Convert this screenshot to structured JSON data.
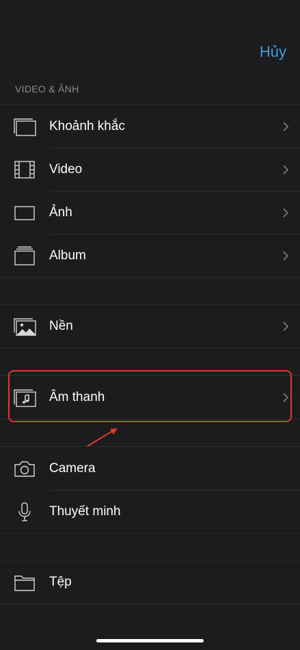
{
  "header": {
    "cancel_label": "Hủy"
  },
  "section_video_photo": {
    "title": "VIDEO & ẢNH",
    "items": [
      {
        "label": "Khoảnh khắc",
        "icon": "moments-icon"
      },
      {
        "label": "Video",
        "icon": "film-icon"
      },
      {
        "label": "Ảnh",
        "icon": "photo-frame-icon"
      },
      {
        "label": "Album",
        "icon": "album-icon"
      }
    ]
  },
  "group_backgrounds": {
    "items": [
      {
        "label": "Nền",
        "icon": "background-image-icon"
      }
    ]
  },
  "group_audio": {
    "items": [
      {
        "label": "Âm thanh",
        "icon": "music-note-icon"
      }
    ]
  },
  "group_capture": {
    "items": [
      {
        "label": "Camera",
        "icon": "camera-icon"
      },
      {
        "label": "Thuyết minh",
        "icon": "microphone-icon"
      }
    ]
  },
  "group_files": {
    "items": [
      {
        "label": "Tệp",
        "icon": "folder-icon"
      }
    ]
  },
  "colors": {
    "accent": "#3d9fe0",
    "background": "#1c1c1e",
    "highlight": "#e13a2c"
  }
}
